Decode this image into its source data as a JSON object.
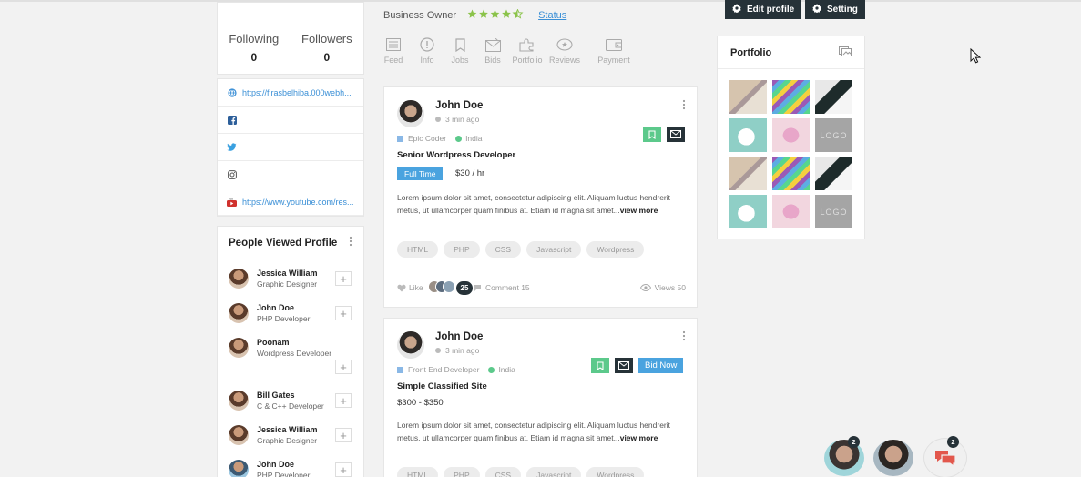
{
  "profile_stats": {
    "following_label": "Following",
    "following_count": "0",
    "followers_label": "Followers",
    "followers_count": "0"
  },
  "social_links": [
    {
      "icon": "globe-icon",
      "text": "https://firasbelhiba.000webh..."
    },
    {
      "icon": "facebook-icon",
      "text": ""
    },
    {
      "icon": "twitter-icon",
      "text": ""
    },
    {
      "icon": "instagram-icon",
      "text": ""
    },
    {
      "icon": "youtube-icon",
      "text": "https://www.youtube.com/res..."
    }
  ],
  "people_viewed": {
    "title": "People Viewed Profile",
    "items": [
      {
        "name": "Jessica William",
        "role": "Graphic Designer"
      },
      {
        "name": "John Doe",
        "role": "PHP Developer"
      },
      {
        "name": "Poonam",
        "role": "Wordpress Developer"
      },
      {
        "name": "Bill Gates",
        "role": "C & C++ Developer"
      },
      {
        "name": "Jessica William",
        "role": "Graphic Designer"
      },
      {
        "name": "John Doe",
        "role": "PHP Developer"
      }
    ]
  },
  "header": {
    "role": "Business Owner",
    "rating": 4.5,
    "status_link": "Status",
    "edit_profile": "Edit profile",
    "setting": "Setting"
  },
  "tabs": [
    "Feed",
    "Info",
    "Jobs",
    "Bids",
    "Portfolio",
    "Reviews",
    "Payment"
  ],
  "posts": [
    {
      "author": "John Doe",
      "time": "3 min ago",
      "category": "Epic Coder",
      "location": "India",
      "title": "Senior Wordpress Developer",
      "job_type": "Full Time",
      "rate": "$30 / hr",
      "description": "Lorem ipsum dolor sit amet, consectetur adipiscing elit. Aliquam luctus hendrerit metus, ut ullamcorper quam finibus at. Etiam id magna sit amet...",
      "view_more": "view more",
      "tags": [
        "HTML",
        "PHP",
        "CSS",
        "Javascript",
        "Wordpress"
      ],
      "like_label": "Like",
      "like_count": "25",
      "comment_label": "Comment 15",
      "views_label": "Views 50"
    },
    {
      "author": "John Doe",
      "time": "3 min ago",
      "category": "Front End Developer",
      "location": "India",
      "title": "Simple Classified Site",
      "bid_button": "Bid Now",
      "budget": "$300 - $350",
      "description": "Lorem ipsum dolor sit amet, consectetur adipiscing elit. Aliquam luctus hendrerit metus, ut ullamcorper quam finibus at. Etiam id magna sit amet...",
      "view_more": "view more",
      "tags": [
        "HTML",
        "PHP",
        "CSS",
        "Javascript",
        "Wordpress"
      ]
    }
  ],
  "portfolio": {
    "title": "Portfolio",
    "logo_text": "LOGO"
  },
  "chat": {
    "avatar1_badge": "2",
    "chat_badge": "2"
  },
  "colors": {
    "accent_blue": "#4aa3df",
    "dark": "#263238",
    "star_green": "#8bc34a",
    "bookmark_green": "#5cc98b"
  }
}
